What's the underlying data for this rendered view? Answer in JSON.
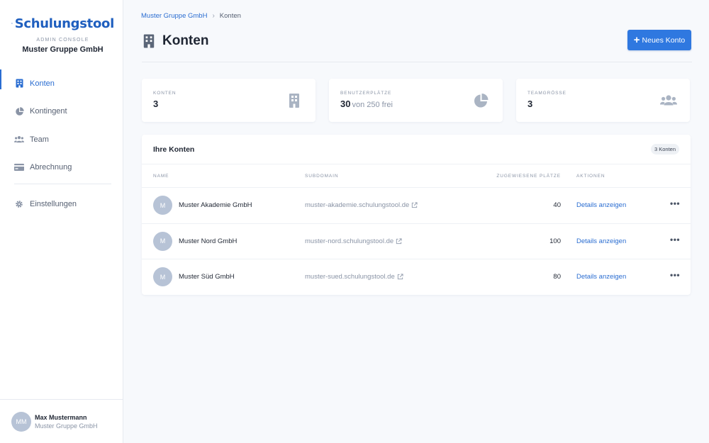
{
  "brand": {
    "name": "Schulungstool",
    "subtitle": "ADMIN CONSOLE",
    "organization": "Muster Gruppe GmbH",
    "color": "#1f5fbf"
  },
  "sidebar": {
    "items": [
      {
        "label": "Konten",
        "icon": "building-icon",
        "active": true
      },
      {
        "label": "Kontingent",
        "icon": "pie-chart-icon",
        "active": false
      },
      {
        "label": "Team",
        "icon": "users-icon",
        "active": false
      },
      {
        "label": "Abrechnung",
        "icon": "credit-card-icon",
        "active": false
      }
    ],
    "settings": {
      "label": "Einstellungen",
      "icon": "gear-icon"
    }
  },
  "user": {
    "initials": "MM",
    "name": "Max Mustermann",
    "organization": "Muster Gruppe GmbH"
  },
  "breadcrumb": {
    "parent": "Muster Gruppe GmbH",
    "separator": "›",
    "current": "Konten"
  },
  "page": {
    "title": "Konten",
    "new_button": "Neues Konto"
  },
  "stats": [
    {
      "label": "KONTEN",
      "value": "3",
      "suffix": "",
      "icon": "building-icon"
    },
    {
      "label": "BENUTZERPLÄTZE",
      "value": "30",
      "suffix": "von 250 frei",
      "icon": "pie-chart-icon"
    },
    {
      "label": "TEAMGRÖSSE",
      "value": "3",
      "suffix": "",
      "icon": "users-icon"
    }
  ],
  "table": {
    "title": "Ihre Konten",
    "badge": "3 Konten",
    "columns": [
      "NAME",
      "SUBDOMAIN",
      "ZUGEWIESENE PLÄTZE",
      "AKTIONEN"
    ],
    "rows": [
      {
        "initial": "M",
        "name": "Muster Akademie GmbH",
        "subdomain": "muster-akademie.schulungstool.de",
        "seats": "40",
        "action": "Details anzeigen",
        "more": "•••"
      },
      {
        "initial": "M",
        "name": "Muster Nord GmbH",
        "subdomain": "muster-nord.schulungstool.de",
        "seats": "100",
        "action": "Details anzeigen",
        "more": "•••"
      },
      {
        "initial": "M",
        "name": "Muster Süd GmbH",
        "subdomain": "muster-sued.schulungstool.de",
        "seats": "80",
        "action": "Details anzeigen",
        "more": "•••"
      }
    ]
  },
  "colors": {
    "accent": "#2a6dd1",
    "button": "#2f78e0",
    "avatar": "#b7c3d6",
    "background": "#f7f9fc"
  }
}
